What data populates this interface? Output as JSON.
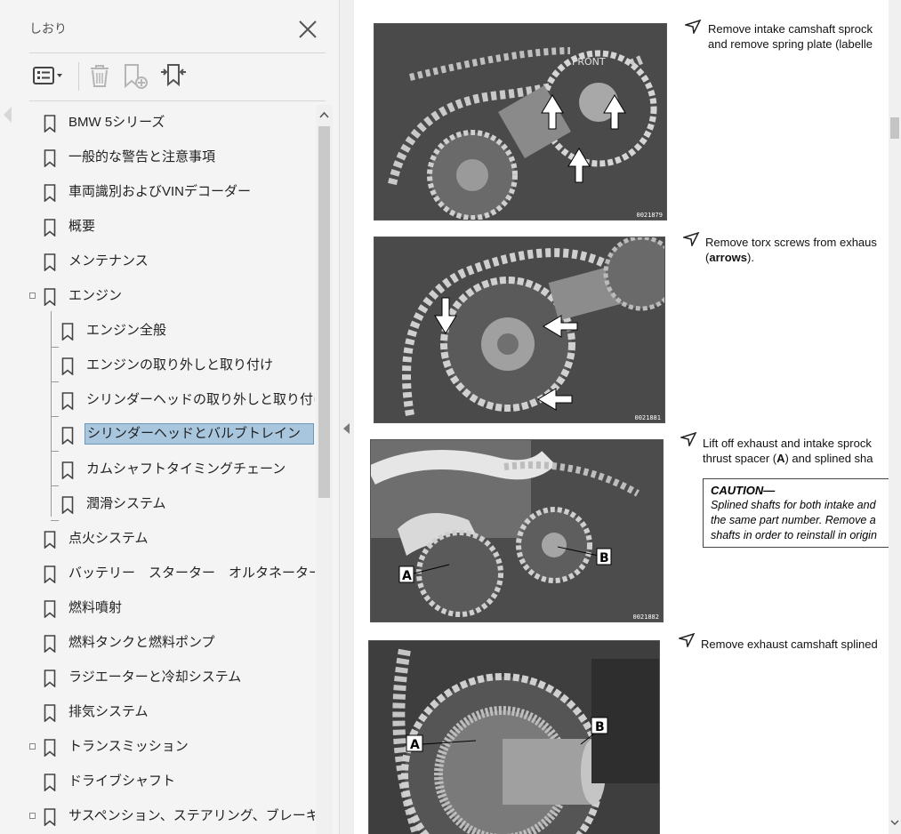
{
  "panel": {
    "title": "しおり",
    "items": [
      {
        "label": "BMW 5シリーズ",
        "level": 0,
        "toggle": false
      },
      {
        "label": "一般的な警告と注意事項",
        "level": 0,
        "toggle": false
      },
      {
        "label": "車両識別およびVINデコーダー",
        "level": 0,
        "toggle": false
      },
      {
        "label": "概要",
        "level": 0,
        "toggle": false
      },
      {
        "label": "メンテナンス",
        "level": 0,
        "toggle": false
      },
      {
        "label": "エンジン",
        "level": 0,
        "toggle": true
      },
      {
        "label": "エンジン全般",
        "level": 1,
        "toggle": false
      },
      {
        "label": "エンジンの取り外しと取り付け",
        "level": 1,
        "toggle": false
      },
      {
        "label": "シリンダーヘッドの取り外しと取り付け",
        "level": 1,
        "toggle": false
      },
      {
        "label": "シリンダーヘッドとバルブトレイン",
        "level": 1,
        "toggle": false,
        "selected": true
      },
      {
        "label": "カムシャフトタイミングチェーン",
        "level": 1,
        "toggle": false
      },
      {
        "label": "潤滑システム",
        "level": 1,
        "toggle": false
      },
      {
        "label": "点火システム",
        "level": 0,
        "toggle": false
      },
      {
        "label": "バッテリー　スターター　オルタネーター",
        "level": 0,
        "toggle": false
      },
      {
        "label": "燃料噴射",
        "level": 0,
        "toggle": false
      },
      {
        "label": "燃料タンクと燃料ポンプ",
        "level": 0,
        "toggle": false
      },
      {
        "label": "ラジエーターと冷却システム",
        "level": 0,
        "toggle": false
      },
      {
        "label": "排気システム",
        "level": 0,
        "toggle": false
      },
      {
        "label": "トランスミッション",
        "level": 0,
        "toggle": true
      },
      {
        "label": "ドライブシャフト",
        "level": 0,
        "toggle": false
      },
      {
        "label": "サスペンション、ステアリング、ブレーキ全般",
        "level": 0,
        "toggle": true
      }
    ]
  },
  "document": {
    "figures": [
      {
        "number": "0021879",
        "caption_line1": "Remove intake camshaft sprock",
        "caption_line2": "and remove spring plate (labelle",
        "photo_text": "FRONT"
      },
      {
        "number": "0021881",
        "caption_line1": "Remove torx screws from exhaus",
        "caption_line2_bold": "arrows",
        "caption_line2_pre": "(",
        "caption_line2_post": ")."
      },
      {
        "number": "0021882",
        "caption_line1": "Lift off exhaust and intake sprock",
        "caption_line2_pre": "thrust spacer (",
        "caption_line2_bold": "A",
        "caption_line2_post": ") and splined sha",
        "label_a": "A",
        "label_b": "B"
      },
      {
        "caption_line1": "Remove exhaust camshaft splined",
        "label_a": "A",
        "label_b": "B"
      }
    ],
    "caution": {
      "title": "CAUTION—",
      "line1": "Splined shafts for both intake and",
      "line2": "the same part number. Remove a",
      "line3": "shafts in order to reinstall in origin"
    }
  },
  "colors": {
    "selection_fill": "#a9c6df",
    "selection_border": "#6f97b8",
    "panel_bg": "#f4f4f4"
  },
  "icons": {
    "close": "close-icon",
    "options": "options-list-icon",
    "delete": "trash-icon",
    "new_bookmark": "add-bookmark-icon",
    "expand": "expand-bookmark-icon",
    "bookmark": "bookmark-icon"
  }
}
